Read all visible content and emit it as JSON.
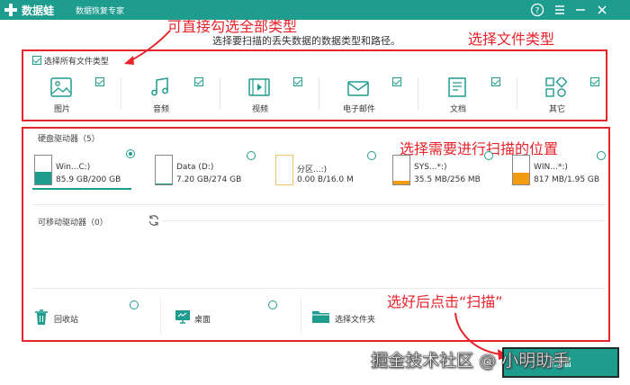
{
  "app": {
    "name": "数据蛙",
    "subtitle": "数据恢复专家"
  },
  "instruction": "选择要扫描的丢失数据的数据类型和路径。",
  "annotations": {
    "select_all_hint": "可直接勾选全部类型",
    "file_types": "选择文件类型",
    "location": "选择需要进行扫描的位置",
    "scan_hint": "选好后点击“扫描”"
  },
  "select_all": {
    "label": "选择所有文件类型",
    "checked": true
  },
  "file_types": [
    {
      "label": "图片",
      "icon": "image-icon",
      "checked": true
    },
    {
      "label": "音频",
      "icon": "music-icon",
      "checked": true
    },
    {
      "label": "视频",
      "icon": "video-icon",
      "checked": true
    },
    {
      "label": "电子邮件",
      "icon": "email-icon",
      "checked": true
    },
    {
      "label": "文档",
      "icon": "document-icon",
      "checked": true
    },
    {
      "label": "其它",
      "icon": "others-icon",
      "checked": true
    }
  ],
  "hard_drives": {
    "title": "硬盘驱动器（5）",
    "items": [
      {
        "name": "Win...C:)",
        "size": "85.9 GB/200 GB",
        "used": 0.43,
        "fill_color": "#1e9c8e",
        "selected": true
      },
      {
        "name": "Data (D:)",
        "size": "7.20 GB/274 GB",
        "used": 0.03,
        "fill_color": "#1e9c8e",
        "selected": false
      },
      {
        "name": "分区...:)",
        "size": "0.00  B/16.0 M",
        "used": 0.0,
        "fill_color": "#1e9c8e",
        "selected": false
      },
      {
        "name": "SYS...*:)",
        "size": "35.5 MB/256 MB",
        "used": 0.14,
        "fill_color": "#f39c12",
        "selected": false
      },
      {
        "name": "WIN...*:)",
        "size": "817 MB/1.95 GB",
        "used": 0.42,
        "fill_color": "#f39c12",
        "selected": false
      }
    ]
  },
  "removable": {
    "title": "可移动驱动器（0）"
  },
  "locations": [
    {
      "label": "回收站",
      "icon": "recycle-bin-icon"
    },
    {
      "label": "桌面",
      "icon": "desktop-icon"
    },
    {
      "label": "选择文件夹",
      "icon": "folder-icon"
    }
  ],
  "scan_button": "扫描",
  "watermark": "掘金技术社区 @ 小明助手",
  "colors": {
    "primary": "#1e9c8e",
    "annotation": "#e8232a",
    "warning": "#f39c12"
  }
}
